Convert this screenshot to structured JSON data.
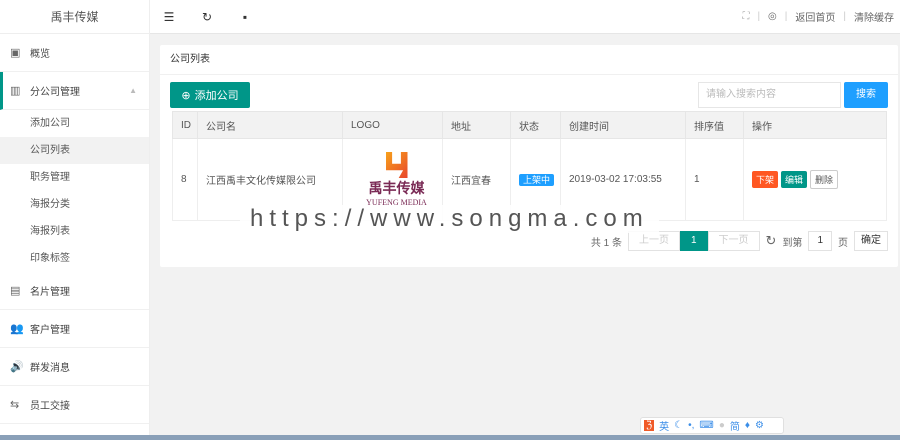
{
  "brand": "禹丰传媒",
  "sidebar": {
    "items": [
      {
        "label": "概览"
      },
      {
        "label": "分公司管理"
      },
      {
        "label": "名片管理"
      },
      {
        "label": "客户管理"
      },
      {
        "label": "群发消息"
      },
      {
        "label": "员工交接"
      }
    ],
    "sub": [
      "添加公司",
      "公司列表",
      "职务管理",
      "海报分类",
      "海报列表",
      "印象标签"
    ]
  },
  "topbar": {
    "home": "返回首页",
    "clear": "清除缓存"
  },
  "card": {
    "title": "公司列表",
    "add": "添加公司",
    "search_placeholder": "请输入搜索内容",
    "search": "搜索"
  },
  "table": {
    "headers": [
      "ID",
      "公司名",
      "LOGO",
      "地址",
      "状态",
      "创建时间",
      "排序值",
      "操作"
    ],
    "rows": [
      {
        "id": "8",
        "name": "江西禹丰文化传媒限公司",
        "logo_text": "禹丰传媒",
        "logo_sub": "YUFENG MEDIA",
        "address": "江西宜春",
        "status": "上架中",
        "created": "2019-03-02 17:03:55",
        "sort": "1",
        "ops": [
          "下架",
          "编辑",
          "删除"
        ]
      }
    ]
  },
  "pagination": {
    "total": "共 1 条",
    "prev": "上一页",
    "current": "1",
    "next": "下一页",
    "goto": "到第",
    "page_input": "1",
    "page_unit": "页",
    "confirm": "确定"
  },
  "watermark": "https://www.songma.com",
  "ime": {
    "lang": "英",
    "simp": "简"
  },
  "colors": {
    "primary": "#009688",
    "blue": "#1e9fff",
    "danger": "#ff5722"
  }
}
